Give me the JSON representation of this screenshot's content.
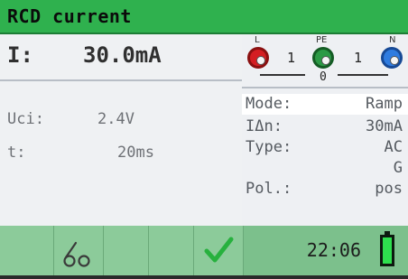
{
  "header": {
    "title": "RCD current"
  },
  "measurement": {
    "main": {
      "label": "I:",
      "value": "30.0mA"
    },
    "uci": {
      "label": "Uci:",
      "value": "2.4V"
    },
    "t": {
      "label": "t:",
      "value": "20ms"
    }
  },
  "terminals": {
    "l_label": "L",
    "pe_label": "PE",
    "n_label": "N",
    "l_pe": "1",
    "pe_n": "1",
    "l_n": "0"
  },
  "params": {
    "mode": {
      "label": "Mode:",
      "value": "Ramp"
    },
    "idn": {
      "label": "IΔn:",
      "value": "30mA"
    },
    "type": {
      "label": "Type:",
      "value": "AC",
      "value2": "G"
    },
    "pol": {
      "label": "Pol.:",
      "value": "pos"
    }
  },
  "footer": {
    "time": "22:06"
  },
  "icons": {
    "probe": "probe-icon",
    "check": "check-icon",
    "battery": "battery-icon"
  },
  "colors": {
    "title_bar": "#2fb14e",
    "footer_bar": "#7cc08c",
    "check": "#27b13e",
    "battery_fill": "#2ee04e"
  }
}
